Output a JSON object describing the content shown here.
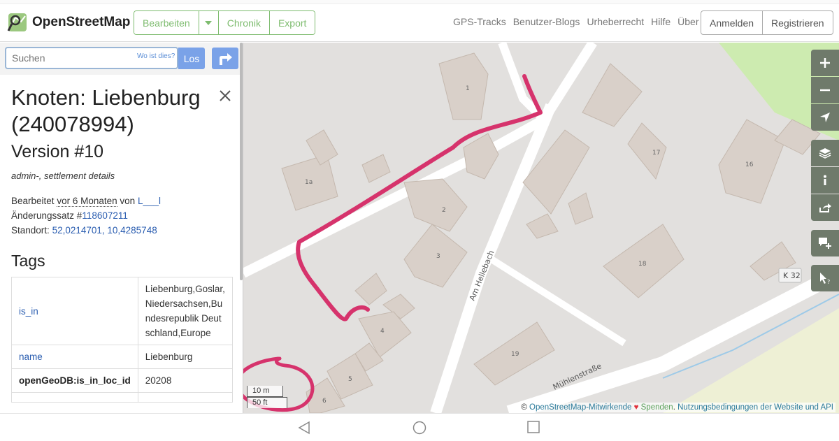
{
  "header": {
    "logo_text": "OpenStreetMap",
    "edit_label": "Bearbeiten",
    "history_label": "Chronik",
    "export_label": "Export",
    "links": [
      "GPS-Tracks",
      "Benutzer-Blogs",
      "Urheberrecht",
      "Hilfe",
      "Über"
    ],
    "login_label": "Anmelden",
    "signup_label": "Registrieren"
  },
  "search": {
    "placeholder": "Suchen",
    "where_label": "Wo ist dies?",
    "go_label": "Los"
  },
  "node": {
    "title": "Knoten: Liebenburg (240078994)",
    "version": "Version #10",
    "tags_summary": "admin-, settlement details",
    "edited_prefix": "Bearbeitet",
    "edited_time": "vor 6 Monaten",
    "edited_by_prefix": "von",
    "edited_user": "L___l",
    "changeset_prefix": "Änderungssatz #",
    "changeset_id": "118607211",
    "location_prefix": "Standort:",
    "location": "52,0214701, 10,4285748"
  },
  "tags_heading": "Tags",
  "tags": [
    {
      "key": "is_in",
      "value": "Liebenburg,Goslar,Niedersachsen,Bundesrepublik Deutschland,Europe"
    },
    {
      "key": "name",
      "value": "Liebenburg"
    },
    {
      "key": "openGeoDB:is_in_loc_id",
      "value": "20208"
    }
  ],
  "map": {
    "street_labels": [
      "Am Hellebach",
      "Mühlenstraße",
      "K 32"
    ],
    "house_numbers": [
      "1",
      "1a",
      "2",
      "3",
      "4",
      "5",
      "6",
      "16",
      "17",
      "18",
      "19"
    ],
    "scale_m": "10 m",
    "scale_ft": "50 ft",
    "attribution_prefix": "©",
    "attribution_contrib": "OpenStreetMap-Mitwirkende",
    "attribution_donate": "Spenden",
    "attribution_terms": "Nutzungsbedingungen der Website und API",
    "annotation_color": "#d6336c",
    "control_color": "#6f7a6b"
  },
  "controls": [
    "plus-icon",
    "minus-icon",
    "locate-icon",
    "layers-icon",
    "info-icon",
    "share-icon",
    "note-icon",
    "query-icon"
  ]
}
